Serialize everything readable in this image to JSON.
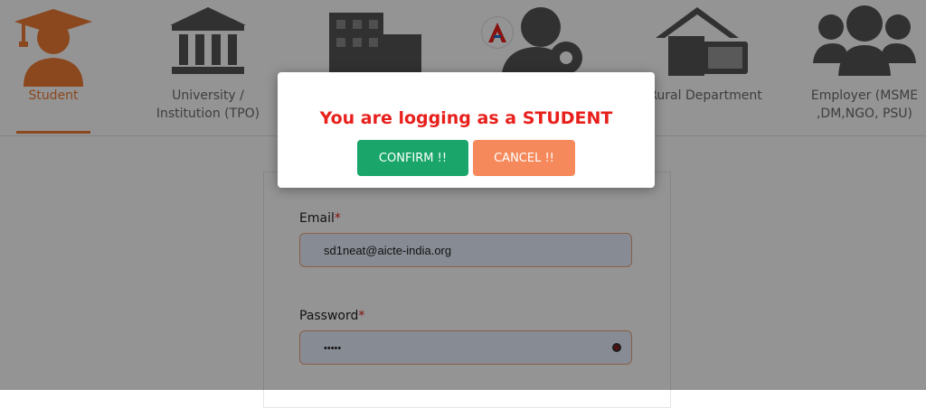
{
  "roles": [
    {
      "label": "Student",
      "icon": "student-graduate-icon",
      "active": true
    },
    {
      "label": "University /\nInstitution (TPO)",
      "icon": "university-building-icon",
      "active": false
    },
    {
      "label": "",
      "icon": "industry-buildings-icon",
      "active": false
    },
    {
      "label": "",
      "icon": "admin-users-gear-icon",
      "active": false
    },
    {
      "label": "Rural Department",
      "icon": "rural-house-icon",
      "active": false
    },
    {
      "label": "Employer (MSME\n,DM,NGO, PSU)",
      "icon": "employer-group-icon",
      "active": false
    }
  ],
  "form": {
    "email_label": "Email",
    "email_value": "sd1neat@aicte-india.org",
    "password_label": "Password",
    "password_value": "•••••",
    "required_mark": "*"
  },
  "modal": {
    "title": "You are logging as a STUDENT",
    "confirm_label": "CONFIRM !!",
    "cancel_label": "CANCEL !!"
  },
  "colors": {
    "accent": "#f07a35",
    "confirm": "#1aa66a",
    "cancel": "#f5895c",
    "alert_text": "#e8201c",
    "icon_gray": "#555555"
  }
}
